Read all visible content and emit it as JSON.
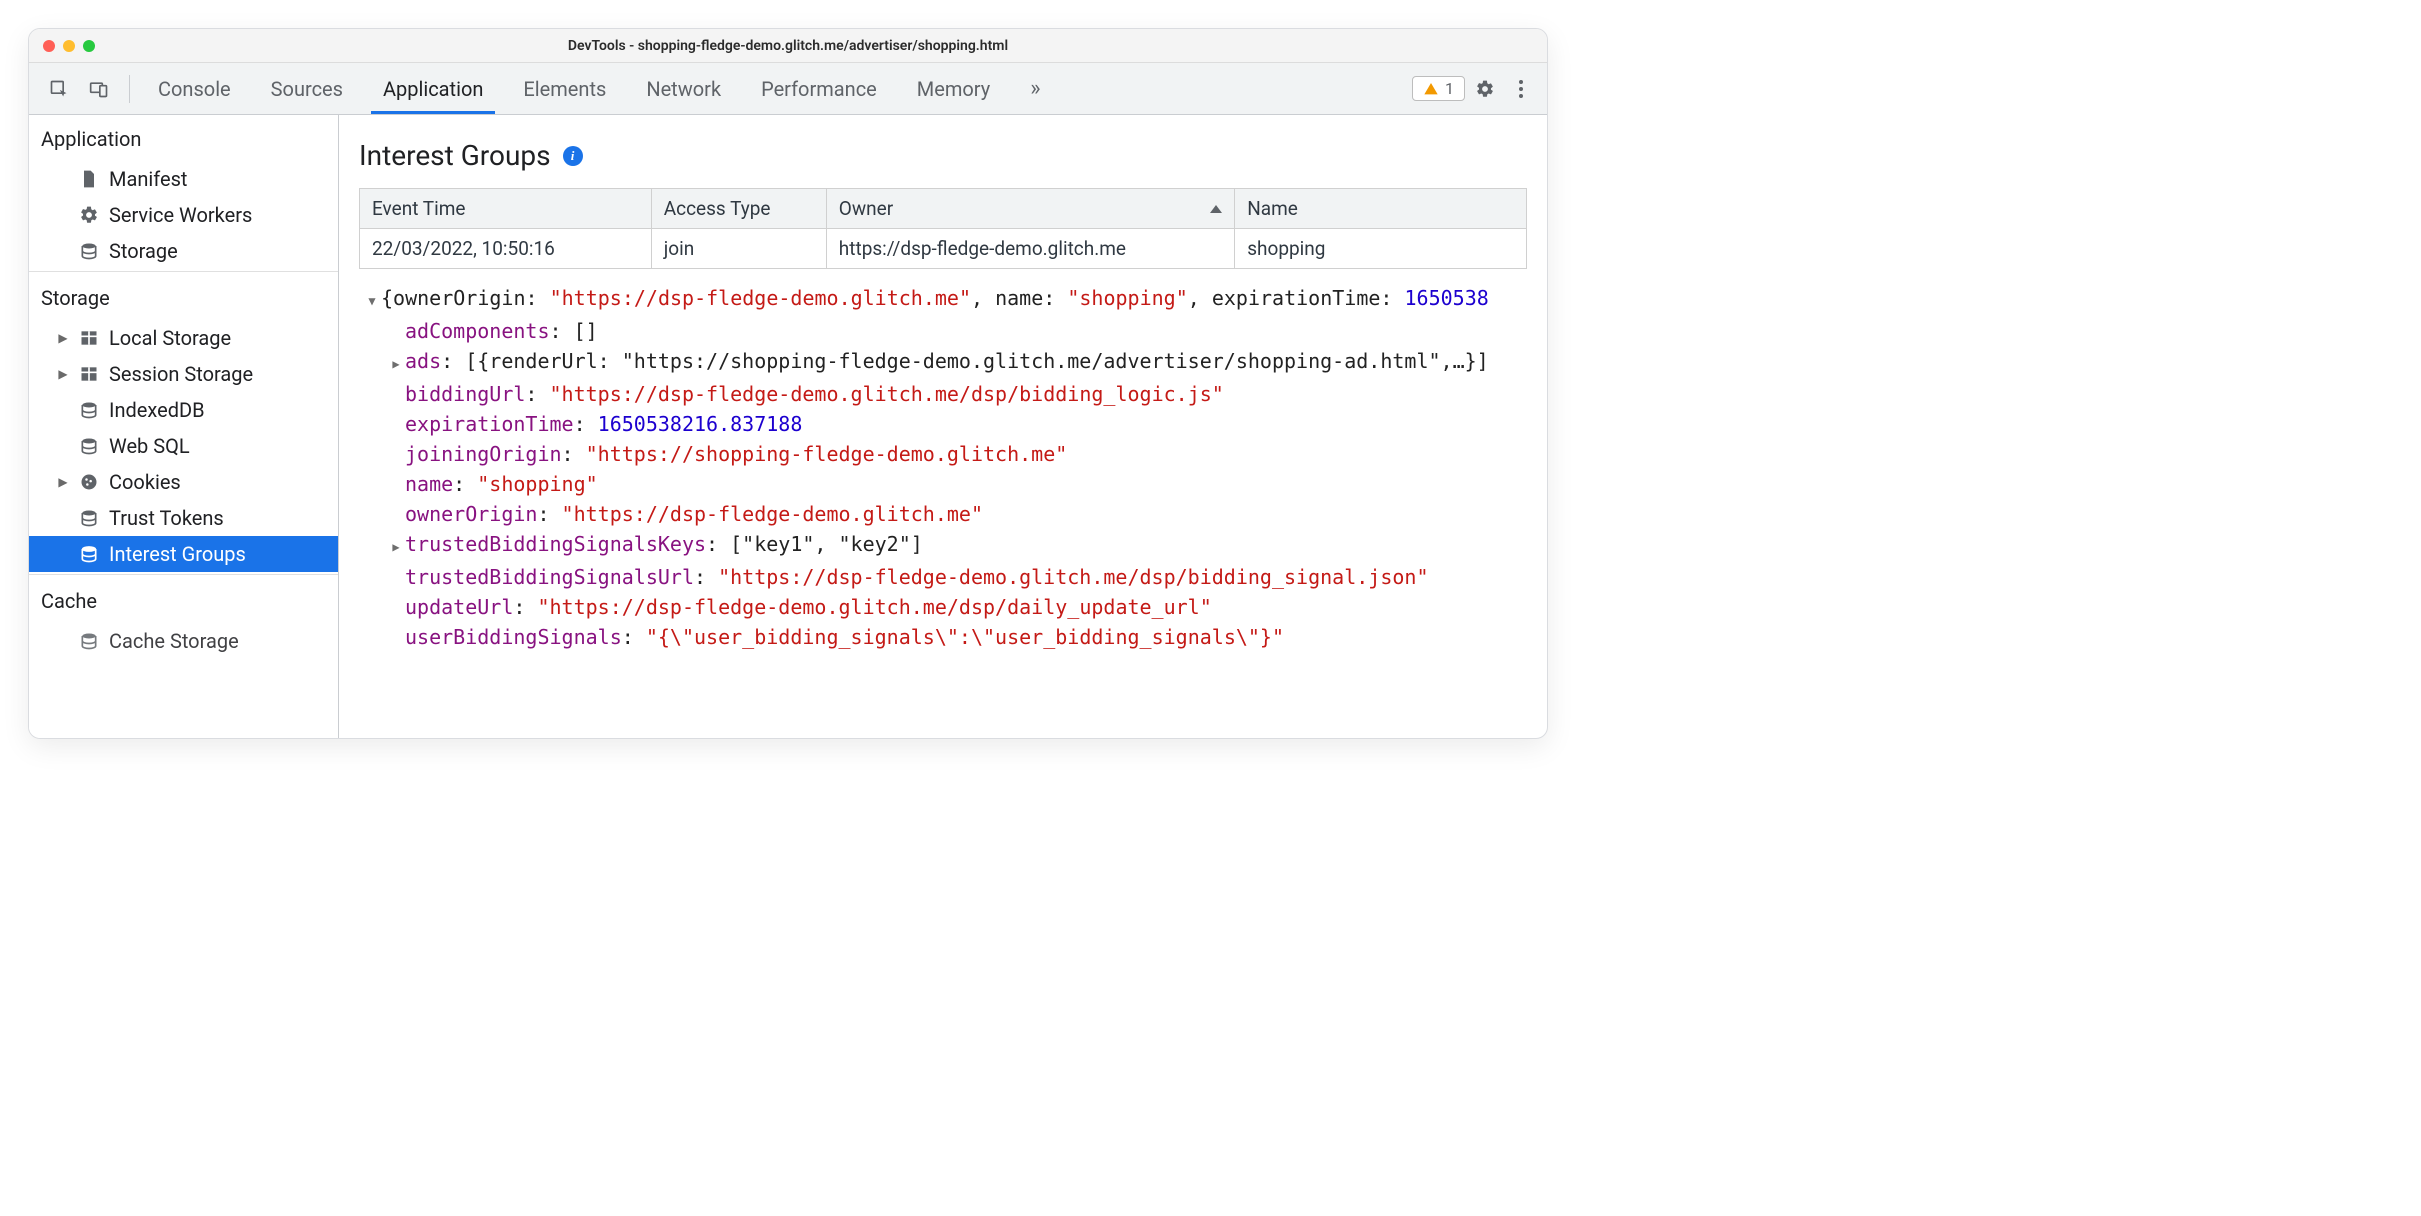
{
  "window_title": "DevTools - shopping-fledge-demo.glitch.me/advertiser/shopping.html",
  "toolbar": {
    "tabs": [
      "Console",
      "Sources",
      "Application",
      "Elements",
      "Network",
      "Performance",
      "Memory"
    ],
    "active_tab": "Application",
    "warning_count": "1"
  },
  "sidebar": {
    "sections": [
      {
        "title": "Application",
        "items": [
          {
            "icon": "file",
            "label": "Manifest",
            "expand": null
          },
          {
            "icon": "gear",
            "label": "Service Workers",
            "expand": null
          },
          {
            "icon": "db",
            "label": "Storage",
            "expand": null
          }
        ]
      },
      {
        "title": "Storage",
        "items": [
          {
            "icon": "grid",
            "label": "Local Storage",
            "expand": "closed"
          },
          {
            "icon": "grid",
            "label": "Session Storage",
            "expand": "closed"
          },
          {
            "icon": "db",
            "label": "IndexedDB",
            "expand": null
          },
          {
            "icon": "db",
            "label": "Web SQL",
            "expand": null
          },
          {
            "icon": "cookie",
            "label": "Cookies",
            "expand": "closed"
          },
          {
            "icon": "db",
            "label": "Trust Tokens",
            "expand": null
          },
          {
            "icon": "db",
            "label": "Interest Groups",
            "expand": null,
            "selected": true
          }
        ]
      },
      {
        "title": "Cache",
        "items": [
          {
            "icon": "db",
            "label": "Cache Storage",
            "expand": null
          }
        ]
      }
    ]
  },
  "panel": {
    "title": "Interest Groups",
    "columns": [
      "Event Time",
      "Access Type",
      "Owner",
      "Name"
    ],
    "sorted_col_index": 2,
    "rows": [
      [
        "22/03/2022, 10:50:16",
        "join",
        "https://dsp-fledge-demo.glitch.me",
        "shopping"
      ]
    ]
  },
  "detail": {
    "summary_prefix": "{ownerOrigin: ",
    "summary_owner": "\"https://dsp-fledge-demo.glitch.me\"",
    "summary_mid1": ", name: ",
    "summary_name": "\"shopping\"",
    "summary_mid2": ", expirationTime: ",
    "summary_exp": "1650538",
    "lines": [
      {
        "key": "adComponents",
        "type": "arr",
        "text": "[]"
      },
      {
        "key": "ads",
        "type": "expand",
        "text": "[{renderUrl: \"https://shopping-fledge-demo.glitch.me/advertiser/shopping-ad.html\",…}]"
      },
      {
        "key": "biddingUrl",
        "type": "str",
        "text": "\"https://dsp-fledge-demo.glitch.me/dsp/bidding_logic.js\""
      },
      {
        "key": "expirationTime",
        "type": "num",
        "text": "1650538216.837188"
      },
      {
        "key": "joiningOrigin",
        "type": "str",
        "text": "\"https://shopping-fledge-demo.glitch.me\""
      },
      {
        "key": "name",
        "type": "str",
        "text": "\"shopping\""
      },
      {
        "key": "ownerOrigin",
        "type": "str",
        "text": "\"https://dsp-fledge-demo.glitch.me\""
      },
      {
        "key": "trustedBiddingSignalsKeys",
        "type": "expand",
        "text": "[\"key1\", \"key2\"]"
      },
      {
        "key": "trustedBiddingSignalsUrl",
        "type": "str",
        "text": "\"https://dsp-fledge-demo.glitch.me/dsp/bidding_signal.json\""
      },
      {
        "key": "updateUrl",
        "type": "str",
        "text": "\"https://dsp-fledge-demo.glitch.me/dsp/daily_update_url\""
      },
      {
        "key": "userBiddingSignals",
        "type": "str",
        "text": "\"{\\\"user_bidding_signals\\\":\\\"user_bidding_signals\\\"}\""
      }
    ]
  }
}
